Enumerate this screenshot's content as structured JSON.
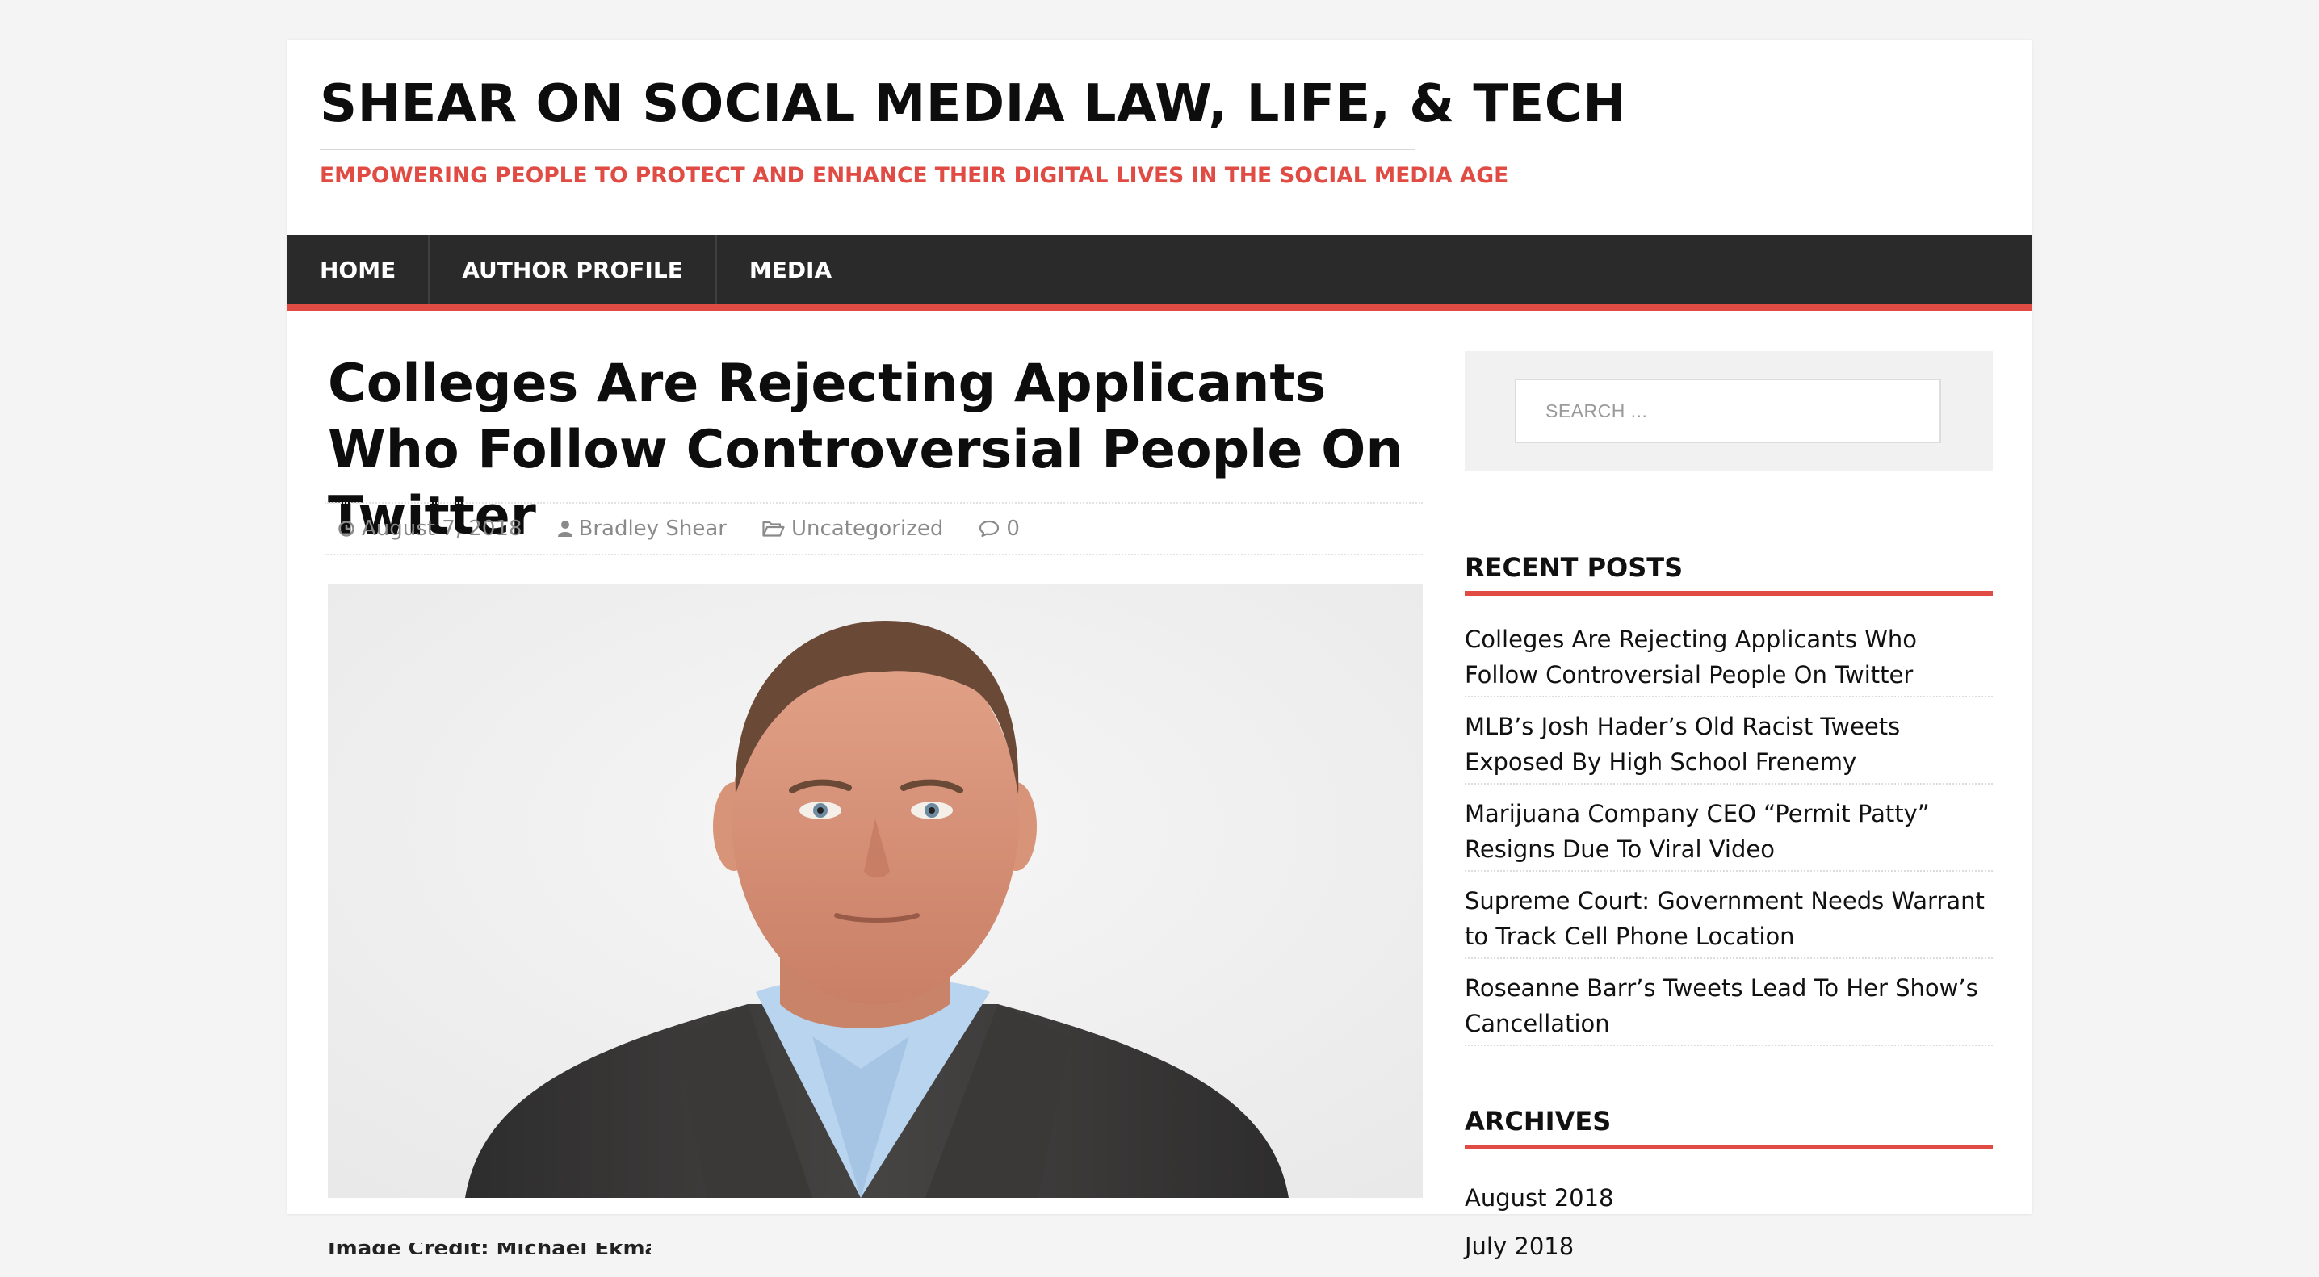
{
  "site": {
    "title": "SHEAR ON SOCIAL MEDIA LAW, LIFE, & TECH",
    "tagline": "EMPOWERING PEOPLE TO PROTECT AND ENHANCE THEIR DIGITAL LIVES IN THE SOCIAL MEDIA AGE",
    "accent_color": "#e04b44",
    "nav_background": "#2a2a2a"
  },
  "nav": {
    "items": [
      {
        "label": "HOME"
      },
      {
        "label": "AUTHOR PROFILE"
      },
      {
        "label": "MEDIA"
      }
    ]
  },
  "article": {
    "title": "Colleges Are Rejecting Applicants Who Follow Controversial People On Twitter",
    "meta": {
      "date": "August 7, 2018",
      "author": "Bradley Shear",
      "category": "Uncategorized",
      "comments": "0"
    },
    "caption": "Image Credit: Michael Ekman"
  },
  "sidebar": {
    "search": {
      "placeholder": "SEARCH ..."
    },
    "recent_posts": {
      "title": "RECENT POSTS",
      "items": [
        {
          "label": "Colleges Are Rejecting Applicants Who Follow Controversial People On Twitter"
        },
        {
          "label": "MLB’s Josh Hader’s Old Racist Tweets Exposed By High School Frenemy"
        },
        {
          "label": "Marijuana Company CEO “Permit Patty” Resigns Due To Viral Video"
        },
        {
          "label": "Supreme Court: Government Needs Warrant to Track Cell Phone Location"
        },
        {
          "label": "Roseanne Barr’s Tweets Lead To Her Show’s Cancellation"
        }
      ]
    },
    "archives": {
      "title": "ARCHIVES",
      "items": [
        {
          "label": "August 2018"
        },
        {
          "label": "July 2018"
        }
      ]
    }
  }
}
